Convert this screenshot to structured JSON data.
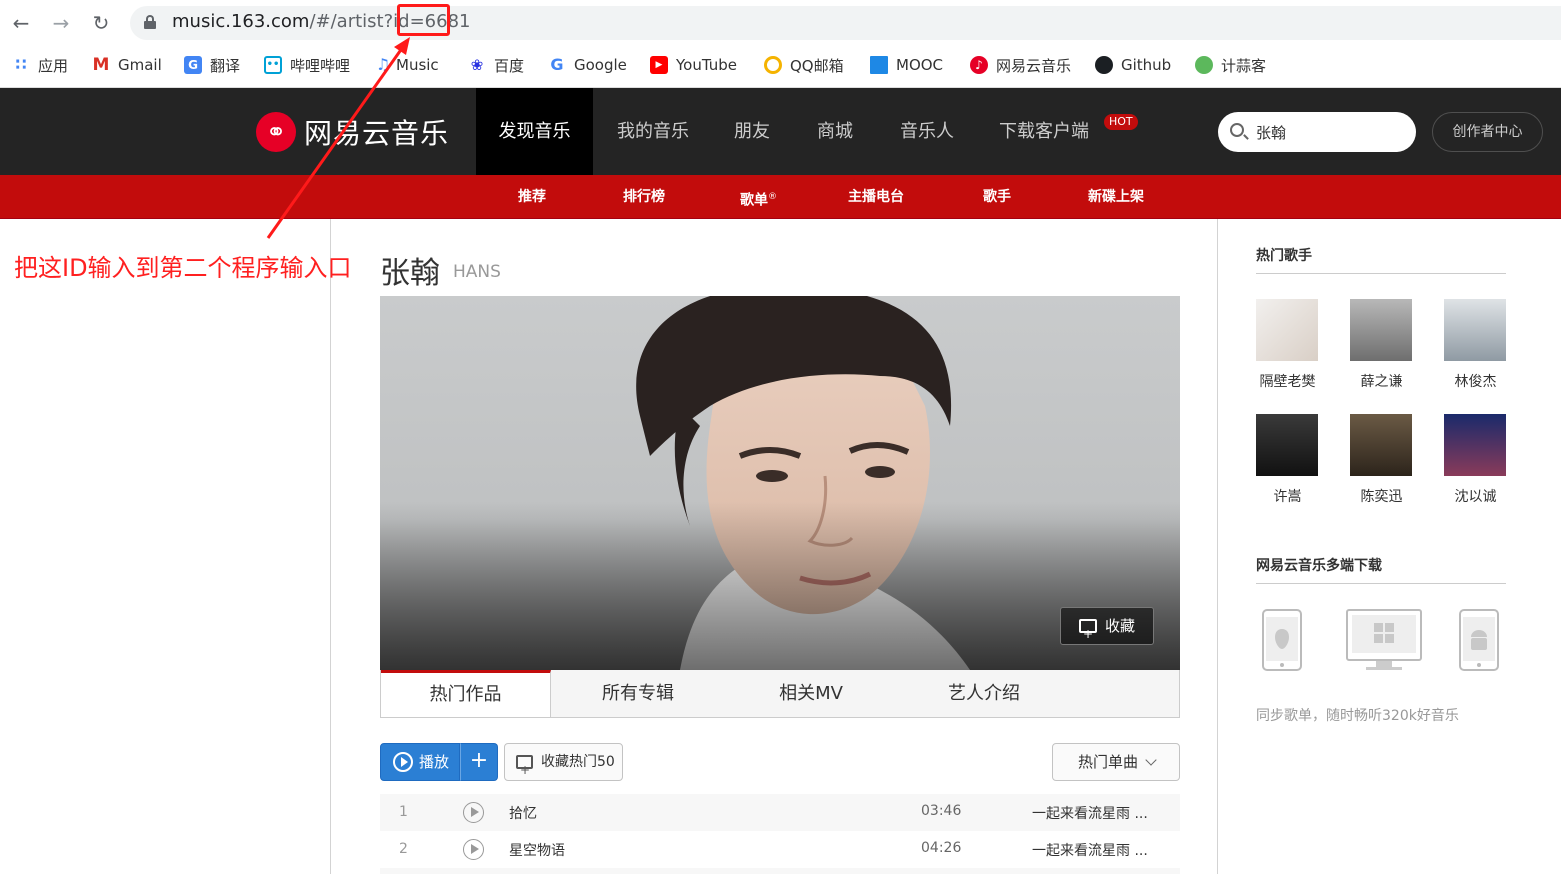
{
  "browser": {
    "url_host": "music.163.com",
    "url_path": "/#/artist?id=",
    "url_id": "6681",
    "bookmarks": [
      {
        "label": "应用",
        "icon": "apps-grid-icon"
      },
      {
        "label": "Gmail",
        "icon": "gmail-icon"
      },
      {
        "label": "翻译",
        "icon": "translate-icon"
      },
      {
        "label": "哔哩哔哩",
        "icon": "bilibili-icon"
      },
      {
        "label": "Music",
        "icon": "music-icon"
      },
      {
        "label": "百度",
        "icon": "baidu-paw-icon"
      },
      {
        "label": "Google",
        "icon": "google-icon"
      },
      {
        "label": "YouTube",
        "icon": "youtube-icon"
      },
      {
        "label": "QQ邮箱",
        "icon": "qqmail-icon"
      },
      {
        "label": "MOOC",
        "icon": "mooc-icon"
      },
      {
        "label": "网易云音乐",
        "icon": "netease-music-icon"
      },
      {
        "label": "Github",
        "icon": "github-icon"
      },
      {
        "label": "计蒜客",
        "icon": "jisuanke-icon"
      }
    ]
  },
  "header": {
    "logo_text": "网易云音乐",
    "nav": [
      "发现音乐",
      "我的音乐",
      "朋友",
      "商城",
      "音乐人",
      "下载客户端"
    ],
    "hot_badge": "HOT",
    "search_value": "张翰",
    "creator_label": "创作者中心"
  },
  "subnav": [
    "推荐",
    "排行榜",
    "歌单",
    "主播电台",
    "歌手",
    "新碟上架"
  ],
  "subnav_sup": "®",
  "annotation": "把这ID输入到第二个程序输入口",
  "artist": {
    "name": "张翰",
    "alias": "HANS",
    "fav_label": "收藏"
  },
  "tabs": [
    "热门作品",
    "所有专辑",
    "相关MV",
    "艺人介绍"
  ],
  "toolbar": {
    "play_label": "播放",
    "add_label": "+",
    "collect_label": "收藏热门50",
    "sort_label": "热门单曲"
  },
  "songs": [
    {
      "index": "1",
      "title": "拾忆",
      "duration": "03:46",
      "album": "一起来看流星雨 ..."
    },
    {
      "index": "2",
      "title": "星空物语",
      "duration": "04:26",
      "album": "一起来看流星雨 ..."
    }
  ],
  "sidebar": {
    "hot_singers_title": "热门歌手",
    "singers": [
      "隔壁老樊",
      "薛之谦",
      "林俊杰",
      "许嵩",
      "陈奕迅",
      "沈以诚"
    ],
    "download_title": "网易云音乐多端下载",
    "download_text": "同步歌单，随时畅听320k好音乐"
  },
  "colors": {
    "brand_red": "#c20c0c",
    "header_dark": "#242424",
    "annotation_red": "#ff2020",
    "play_blue": "#2b7fd4"
  }
}
